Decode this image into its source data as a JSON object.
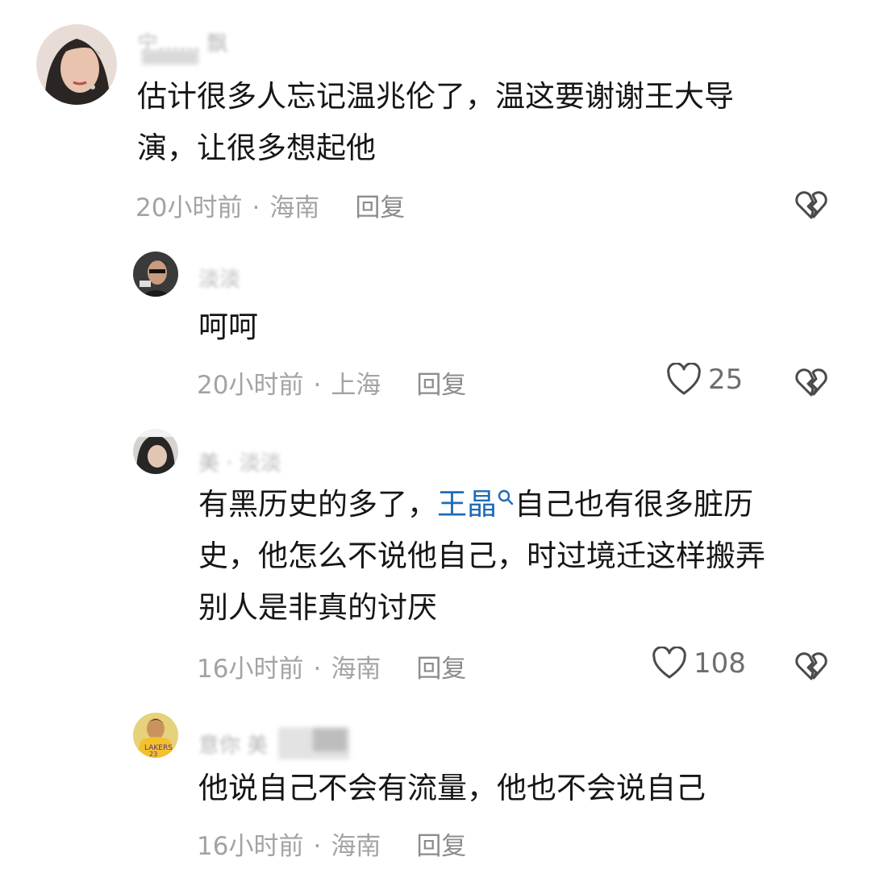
{
  "comments": [
    {
      "username": "宁…… 飘",
      "text_lines": [
        "估计很多人忘记温兆伦了，温这要谢谢王大导",
        "演，让很多想起他"
      ],
      "time": "20小时前",
      "location": "海南",
      "reply_label": "回复",
      "likes": null
    },
    {
      "username": "淡淡",
      "text_lines": [
        "呵呵"
      ],
      "time": "20小时前",
      "location": "上海",
      "reply_label": "回复",
      "likes": "25"
    },
    {
      "username": "美 · 淡淡",
      "text_before_mention": "有黑历史的多了，",
      "mention": "王晶",
      "text_after_mention": "自己也有很多脏历",
      "text_lines": [
        "史，他怎么不说他自己，时过境迁这样搬弄",
        "别人是非真的讨厌"
      ],
      "time": "16小时前",
      "location": "海南",
      "reply_label": "回复",
      "likes": "108"
    },
    {
      "username": "意你 美",
      "text_lines": [
        "他说自己不会有流量，他也不会说自己"
      ],
      "time": "16小时前",
      "location": "海南",
      "reply_label": "回复",
      "likes": null
    }
  ],
  "meta_separator": "·",
  "icons": {
    "like": "heart-outline-icon",
    "dislike": "broken-heart-icon",
    "search": "search-icon"
  },
  "colors": {
    "text": "#161616",
    "meta": "#a3a3a3",
    "mention": "#1f6db5"
  }
}
